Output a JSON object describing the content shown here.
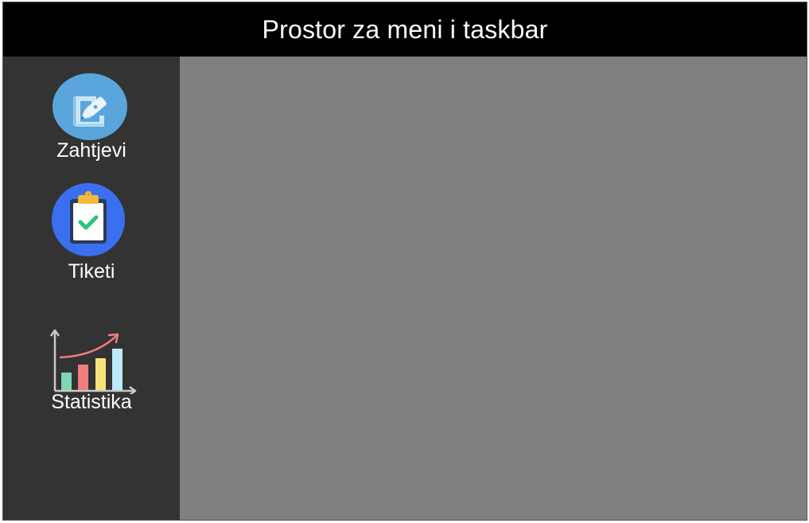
{
  "topbar": {
    "title": "Prostor za meni i taskbar"
  },
  "sidebar": {
    "items": [
      {
        "label": "Zahtjevi",
        "icon": "edit-document-icon"
      },
      {
        "label": "Tiketi",
        "icon": "clipboard-check-icon"
      },
      {
        "label": "Statistika",
        "icon": "bar-chart-icon"
      }
    ]
  },
  "colors": {
    "topbar_bg": "#000000",
    "sidebar_bg": "#333333",
    "content_bg": "#808080",
    "zahtjevi_icon_bg": "#5aa5dc",
    "tiketi_icon_bg": "#3a6ff0"
  }
}
